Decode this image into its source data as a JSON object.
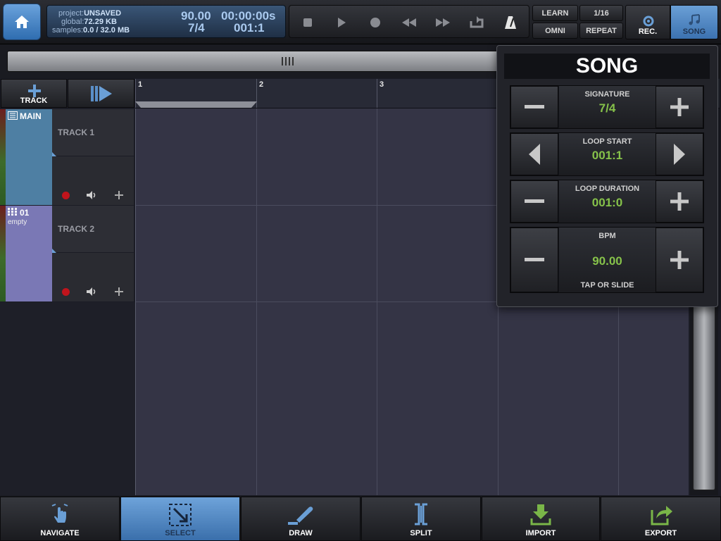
{
  "colors": {
    "accent": "#4a84c4",
    "green_value": "#86c24a",
    "track1_color": "#4e7fa3",
    "track2_color": "#7a78b5",
    "record_red": "#c0141c"
  },
  "info": {
    "project_label": "project:",
    "project_value": "UNSAVED",
    "global_label": "global:",
    "global_value": "72.29 KB",
    "samples_label": "samples:",
    "samples_value": "0.0 / 32.0 MB",
    "bpm": "90.00",
    "time": "00:00:00s",
    "signature": "7/4",
    "position": "001:1"
  },
  "transport": {
    "icons": [
      "stop-icon",
      "play-icon",
      "record-icon",
      "rewind-icon",
      "fast-forward-icon",
      "loop-icon",
      "metronome-icon"
    ]
  },
  "top_buttons": {
    "learn": "LEARN",
    "quantize": "1/16",
    "omni": "OMNI",
    "repeat": "REPEAT",
    "rec": "REC.",
    "song": "SONG"
  },
  "track_header": {
    "add_track_label": "TRACK"
  },
  "ruler": {
    "bars": [
      "1",
      "2",
      "3"
    ]
  },
  "tracks": [
    {
      "tag": "MAIN",
      "sub": "",
      "name": "TRACK 1"
    },
    {
      "tag": "01",
      "sub": "empty",
      "name": "TRACK 2"
    }
  ],
  "song_panel": {
    "title": "SONG",
    "signature_label": "SIGNATURE",
    "signature_value": "7/4",
    "loop_start_label": "LOOP START",
    "loop_start_value": "001:1",
    "loop_duration_label": "LOOP DURATION",
    "loop_duration_value": "001:0",
    "bpm_label": "BPM",
    "bpm_value": "90.00",
    "bpm_hint": "TAP OR SLIDE"
  },
  "tools": {
    "navigate": "NAVIGATE",
    "select": "SELECT",
    "draw": "DRAW",
    "split": "SPLIT",
    "import": "IMPORT",
    "export": "EXPORT"
  }
}
